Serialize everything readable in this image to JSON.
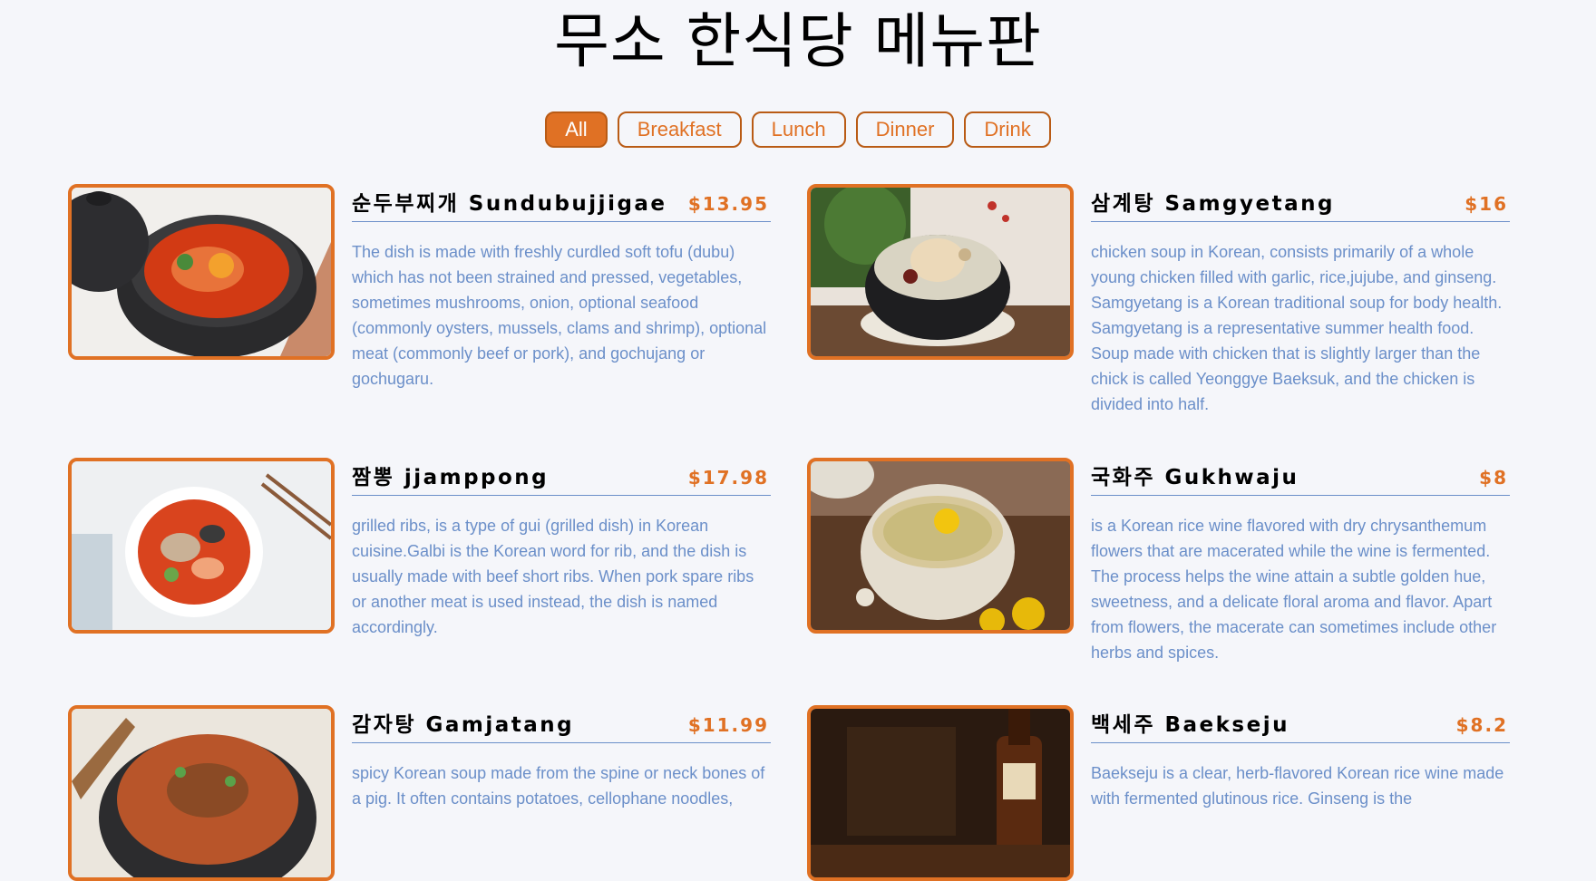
{
  "header": {
    "title": "무소 한식당 메뉴판"
  },
  "filters": [
    {
      "label": "All",
      "active": true
    },
    {
      "label": "Breakfast",
      "active": false
    },
    {
      "label": "Lunch",
      "active": false
    },
    {
      "label": "Dinner",
      "active": false
    },
    {
      "label": "Drink",
      "active": false
    }
  ],
  "menu": [
    {
      "name": "순두부찌개 Sundubujjigae",
      "price": "$13.95",
      "description": "The dish is made with freshly curdled soft tofu (dubu) which has not been strained and pressed, vegetables, sometimes mushrooms, onion, optional seafood (commonly oysters, mussels, clams and shrimp), optional meat (commonly beef or pork), and gochujang or gochugaru.",
      "image": "sundubu-stew-photo"
    },
    {
      "name": "삼계탕 Samgyetang",
      "price": "$16",
      "description": "chicken soup in Korean, consists primarily of a whole young chicken filled with garlic, rice,jujube, and ginseng. Samgyetang is a Korean traditional soup for body health. Samgyetang is a representative summer health food. Soup made with chicken that is slightly larger than the chick is called Yeonggye Baeksuk, and the chicken is divided into half.",
      "image": "samgyetang-soup-photo"
    },
    {
      "name": "짬뽕 jjamppong",
      "price": "$17.98",
      "description": "grilled ribs, is a type of gui (grilled dish) in Korean cuisine.Galbi is the Korean word for rib, and the dish is usually made with beef short ribs. When pork spare ribs or another meat is used instead, the dish is named accordingly.",
      "image": "jjamppong-noodle-photo"
    },
    {
      "name": "국화주 Gukhwaju",
      "price": "$8",
      "description": "is a Korean rice wine flavored with dry chrysanthemum flowers that are macerated while the wine is fermented. The process helps the wine attain a subtle golden hue, sweetness, and a delicate floral aroma and flavor. Apart from flowers, the macerate can sometimes include other herbs and spices.",
      "image": "gukhwaju-wine-photo"
    },
    {
      "name": "감자탕 Gamjatang",
      "price": "$11.99",
      "description": "spicy Korean soup made from the spine or neck bones of a pig. It often contains potatoes, cellophane noodles,",
      "image": "gamjatang-soup-photo"
    },
    {
      "name": "백세주 Baekseju",
      "price": "$8.2",
      "description": "Baekseju is a clear, herb-flavored Korean rice wine made with fermented glutinous rice. Ginseng is the",
      "image": "baekseju-bottle-photo"
    }
  ],
  "colors": {
    "accent": "#e07124",
    "accent_dark": "#b95b15",
    "description_text": "#6b8fc9",
    "background": "#f5f6fa"
  }
}
